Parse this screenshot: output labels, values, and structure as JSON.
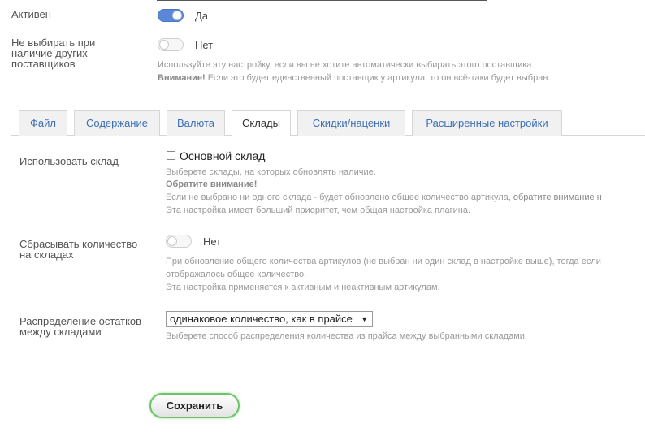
{
  "active": {
    "label": "Активен",
    "value": "Да"
  },
  "no_auto": {
    "label_lines": [
      "Не выбирать при",
      "наличие других",
      "поставщиков"
    ],
    "value": "Нет",
    "hint_line1": "Используйте эту настройку, если вы не хотите автоматически выбирать этого поставщика.",
    "hint_bold": "Внимание!",
    "hint_rest": " Если это будет единственный поставщик у артикула, то он всё-таки будет выбран."
  },
  "tabs": [
    {
      "label": "Файл"
    },
    {
      "label": "Содержание"
    },
    {
      "label": "Валюта"
    },
    {
      "label": "Склады"
    },
    {
      "label": "Скидки/наценки"
    },
    {
      "label": "Расширенные настройки"
    }
  ],
  "use_warehouse": {
    "label": "Использовать склад",
    "checkbox_label": "Основной склад",
    "hint1": "Выберете склады, на которых обновлять наличие.",
    "attention": "Обратите внимание!",
    "hint2_prefix": "Если не выбрано ни одного склада - будет обновлено общее количество артикула, ",
    "hint2_link": "обратите внимание н",
    "hint3": "Эта настройка имеет больший приоритет, чем общая настройка плагина."
  },
  "reset_qty": {
    "label_lines": [
      "Сбрасывать количество",
      "на складах"
    ],
    "value": "Нет",
    "hint1": "При обновление общего количества артикулов (не выбран ни один склад в настройке выше), тогда если",
    "hint2": "отображалось общее количество.",
    "hint3": "Эта настройка применяется к активным и неактивным артикулам."
  },
  "distribution": {
    "label_lines": [
      "Распределение остатков",
      "между складами"
    ],
    "selected": "одинаковое количество, как в прайсе",
    "hint": "Выберете способ распределения количества из прайса между выбранными складами."
  },
  "save_button": "Сохранить",
  "colors": {
    "accent": "#5b87d9",
    "tab_link": "#3d6fb5",
    "save_border": "#6fc46a"
  }
}
